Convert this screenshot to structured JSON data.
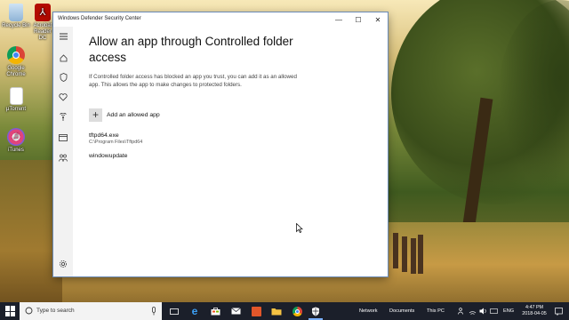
{
  "desktop": {
    "icons": [
      {
        "label": "Recycle Bin",
        "icon": "recycle-bin-icon"
      },
      {
        "label": "Acrobat Reader DC",
        "icon": "acrobat-icon"
      },
      {
        "label": "Google Chrome",
        "icon": "chrome-icon"
      },
      {
        "label": "µTorrent",
        "icon": "utorrent-icon"
      },
      {
        "label": "iTunes",
        "icon": "itunes-icon"
      }
    ]
  },
  "window": {
    "title": "Windows Defender Security Center",
    "controls": {
      "minimize": "—",
      "maximize": "☐",
      "close": "✕"
    },
    "sidebar": [
      "menu-icon",
      "home-icon",
      "shield-icon",
      "heart-icon",
      "wifi-icon",
      "browser-icon",
      "family-icon",
      "settings-icon"
    ],
    "heading": "Allow an app through Controlled folder access",
    "description": "If Controlled folder access has blocked an app you trust, you can add it as an allowed app. This allows the app to make changes to protected folders.",
    "add_button": {
      "symbol": "+",
      "label": "Add an allowed app"
    },
    "apps": [
      {
        "name": "tftpd64.exe",
        "path": "C:\\Program Files\\Tftpd64"
      },
      {
        "name": "windowupdate",
        "path": ""
      }
    ]
  },
  "taskbar": {
    "search_placeholder": "Type to search",
    "toolbars": [
      "Network",
      "Documents",
      "This PC"
    ],
    "language": "ENG",
    "time": "4:47 PM",
    "date": "2018-04-05",
    "accent": "#1b1f2a"
  }
}
